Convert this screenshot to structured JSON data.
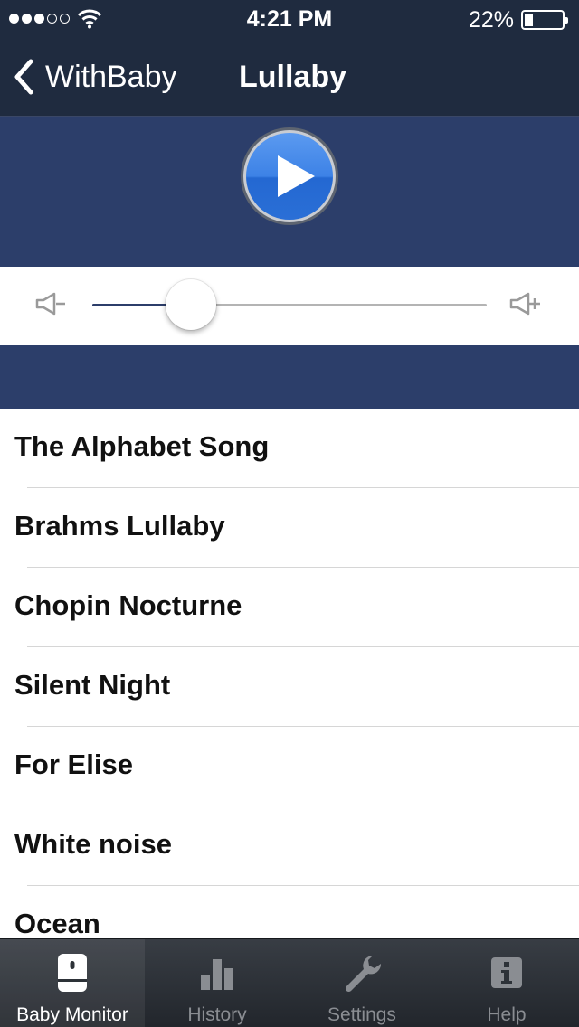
{
  "status_bar": {
    "time": "4:21 PM",
    "battery_percent": "22%",
    "battery_level": 0.22,
    "signal_bars_filled": 3,
    "signal_bars_total": 5
  },
  "nav": {
    "back_label": "WithBaby",
    "title": "Lullaby"
  },
  "player": {
    "play_icon": "play-icon",
    "volume_level": 0.25
  },
  "songs": [
    "The Alphabet Song",
    "Brahms Lullaby",
    "Chopin Nocturne",
    "Silent Night",
    "For Elise",
    "White noise",
    "Ocean"
  ],
  "tabs": [
    {
      "label": "Baby Monitor",
      "icon": "baby-monitor-icon",
      "active": true
    },
    {
      "label": "History",
      "icon": "bar-chart-icon",
      "active": false
    },
    {
      "label": "Settings",
      "icon": "wrench-icon",
      "active": false
    },
    {
      "label": "Help",
      "icon": "info-icon",
      "active": false
    }
  ],
  "colors": {
    "nav_bg": "#1f2b3f",
    "accent_blue": "#2c3e6a",
    "play_blue": "#2a6fd6"
  }
}
